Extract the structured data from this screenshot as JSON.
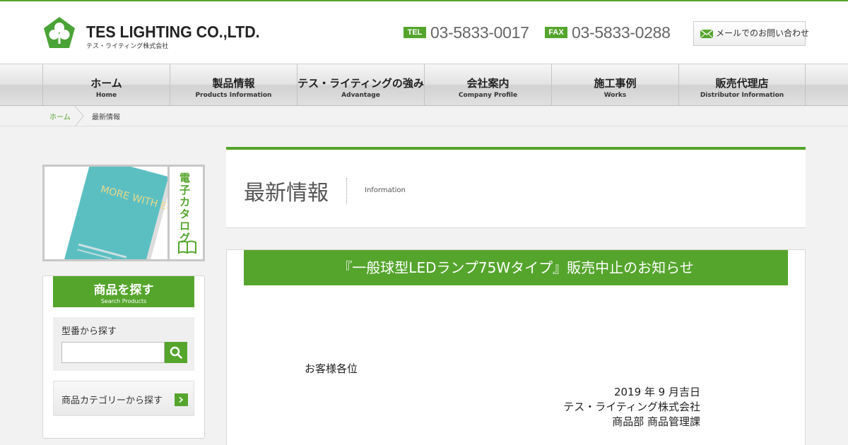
{
  "header": {
    "company_name": "TES LIGHTING CO.,LTD.",
    "company_name_jp": "テス・ライティング株式会社",
    "tel_label": "TEL",
    "tel_number": "03-5833-0017",
    "fax_label": "FAX",
    "fax_number": "03-5833-0288",
    "mail_button": "メールでのお問い合わせ",
    "accent_color": "#55a52d"
  },
  "nav": {
    "items": [
      {
        "jp": "ホーム",
        "en": "Home"
      },
      {
        "jp": "製品情報",
        "en": "Products Information"
      },
      {
        "jp": "テス・ライティングの強み",
        "en": "Advantage"
      },
      {
        "jp": "会社案内",
        "en": "Company Profile"
      },
      {
        "jp": "施工事例",
        "en": "Works"
      },
      {
        "jp": "販売代理店",
        "en": "Distributor Information"
      }
    ]
  },
  "breadcrumb": {
    "home": "ホーム",
    "current": "最新情報"
  },
  "sidebar": {
    "catalog_label": "電子カタログ",
    "catalog_cover_text": "MORE WITH ECO",
    "search": {
      "title": "商品を探す",
      "title_en": "Search Products",
      "model_label": "型番から探す",
      "model_input_value": "",
      "category_button": "商品カテゴリーから探す"
    }
  },
  "main": {
    "title": "最新情報",
    "title_en": "Information",
    "article": {
      "headline": "『一般球型LEDランプ75Wタイプ』販売中止のお知らせ",
      "salutation": "お客様各位",
      "date": "2019 年 9 月吉日",
      "company": "テス・ライティング株式会社",
      "department": "商品部 商品管理課"
    }
  }
}
